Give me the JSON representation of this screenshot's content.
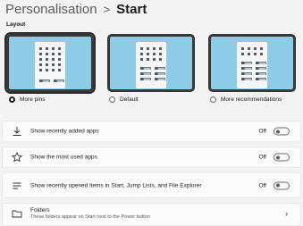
{
  "breadcrumb": {
    "parent": "Personalisation",
    "separator": ">",
    "current": "Start"
  },
  "layout_section": {
    "label": "Layout"
  },
  "layout_options": [
    {
      "label": "More pins",
      "selected": true
    },
    {
      "label": "Default",
      "selected": false
    },
    {
      "label": "More recommendations",
      "selected": false
    }
  ],
  "settings": [
    {
      "label": "Show recently added apps",
      "state": "Off",
      "icon": "download-icon"
    },
    {
      "label": "Show the most used apps",
      "state": "Off",
      "icon": "star-icon"
    },
    {
      "label": "Show recently opened items in Start, Jump Lists, and File Explorer",
      "state": "Off",
      "icon": "list-icon"
    }
  ],
  "folders": {
    "title": "Folders",
    "subtitle": "These folders appear on Start next to the Power button",
    "icon": "folder-icon"
  }
}
